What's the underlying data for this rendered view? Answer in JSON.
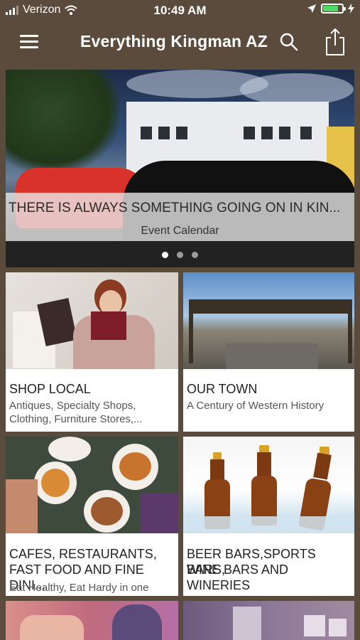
{
  "status": {
    "carrier": "Verizon",
    "time": "10:49 AM"
  },
  "nav": {
    "title": "Everything Kingman AZ"
  },
  "hero": {
    "headline": "THERE IS ALWAYS SOMETHING GOING ON IN KIN...",
    "subline": "Event Calendar",
    "dots": 3,
    "active_dot": 0
  },
  "cards": [
    {
      "title": "SHOP LOCAL",
      "sub1": "Antiques, Specialty Shops,",
      "sub2": "Clothing, Furniture Stores,..."
    },
    {
      "title": "OUR TOWN",
      "sub1": "A Century of Western History",
      "sub2": ""
    },
    {
      "title1": "CAFES, RESTAURANTS,",
      "title2": "FAST FOOD AND FINE DINI...",
      "sub1": "Eat Healthy, Eat Hardy in one"
    },
    {
      "title1": "BEER BARS,SPORTS BARS,",
      "title2": "WINE BARS AND WINERIES"
    }
  ],
  "colors": {
    "background": "#5b4b3d",
    "card": "#ffffff",
    "battery": "#4cd964"
  },
  "icons": [
    "signal-icon",
    "wifi-icon",
    "location-arrow-icon",
    "battery-icon",
    "charging-icon",
    "menu-icon",
    "search-icon",
    "share-icon"
  ]
}
